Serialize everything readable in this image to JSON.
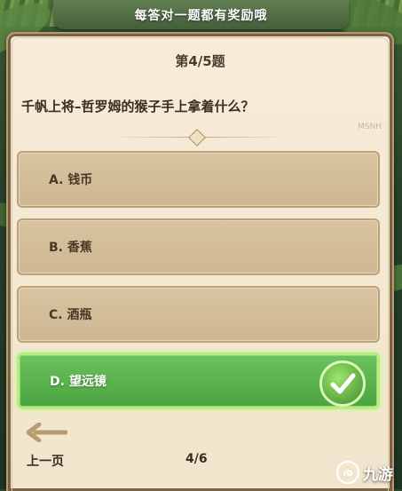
{
  "header": {
    "banner_text": "每答对一题都有奖励哦"
  },
  "question": {
    "number_label": "第4/5题",
    "text": "千帆上将–哲罗姆的猴子手上拿着什么？",
    "corner_text": "MSNH"
  },
  "options": [
    {
      "label": "A. 钱币",
      "state": "normal"
    },
    {
      "label": "B. 香蕉",
      "state": "normal"
    },
    {
      "label": "C. 酒瓶",
      "state": "normal"
    },
    {
      "label": "D. 望远镜",
      "state": "correct"
    }
  ],
  "footer": {
    "prev_label": "上一页",
    "page_indicator": "4/6"
  },
  "watermark": {
    "text": "九游"
  },
  "colors": {
    "correct_green": "#4aa43f",
    "parchment": "#f3e8d1",
    "option_tan": "#d3bd98"
  },
  "icons": {
    "back": "left-arrow-icon",
    "correct": "checkmark-icon",
    "watermark": "jiuyou-logo-icon"
  }
}
